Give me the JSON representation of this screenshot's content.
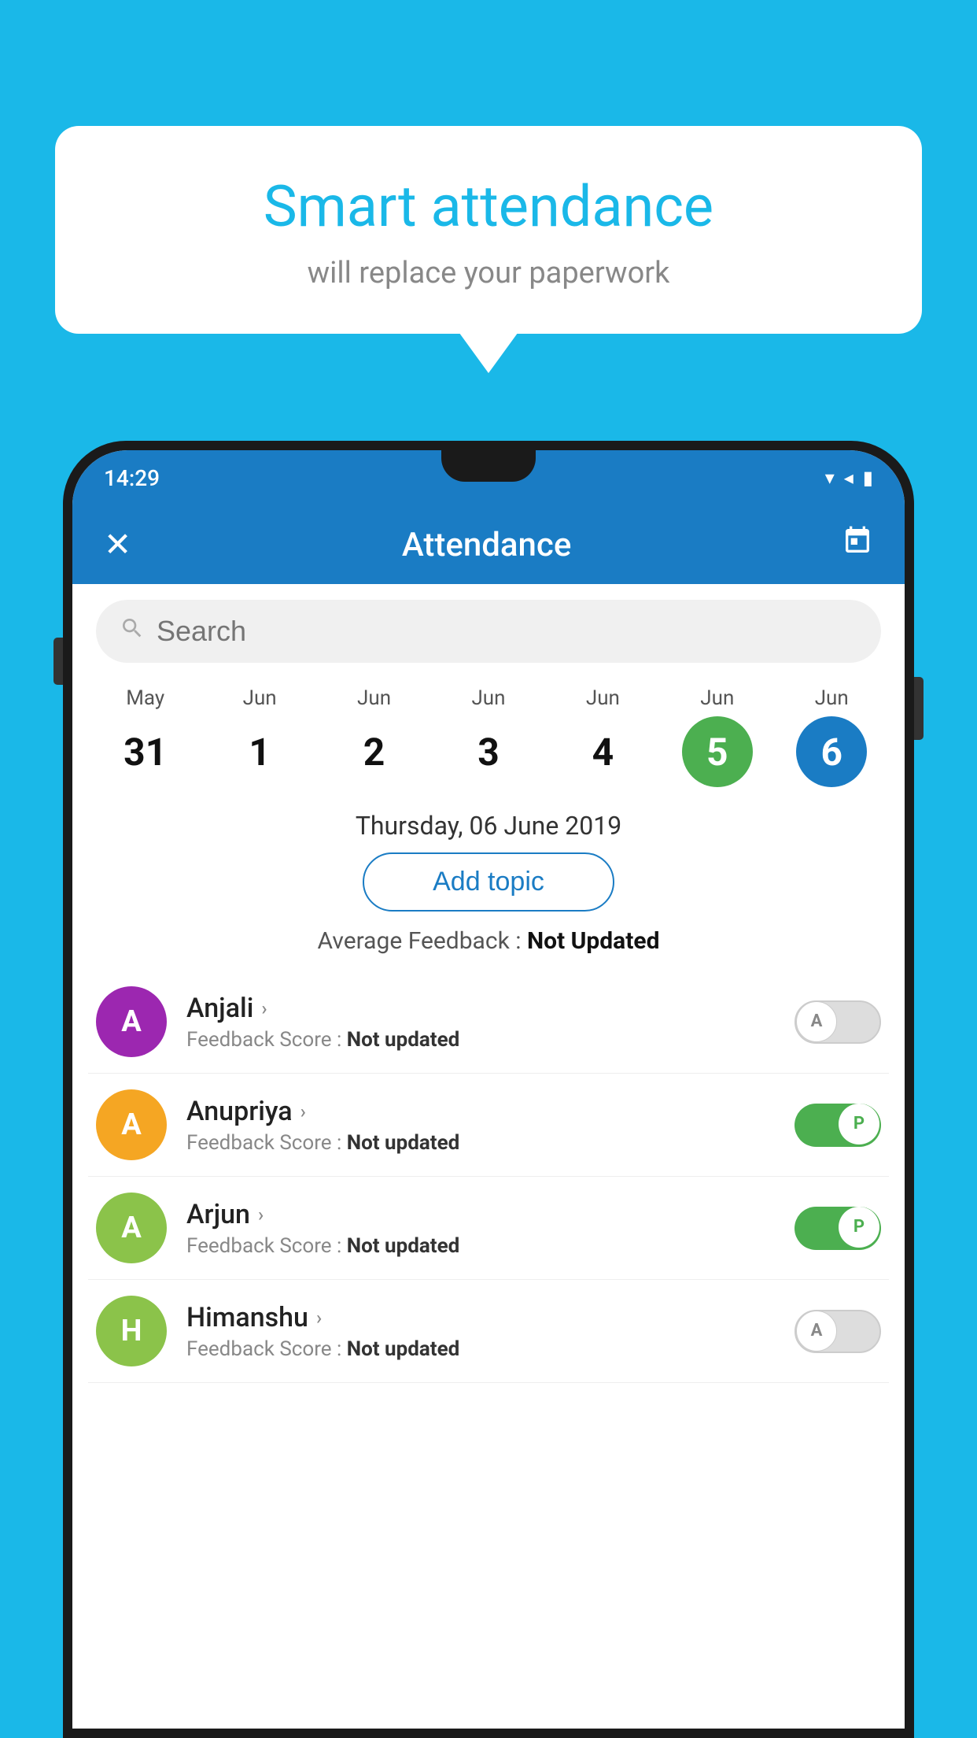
{
  "background": {
    "color": "#1ab8e8"
  },
  "speech_bubble": {
    "title": "Smart attendance",
    "subtitle": "will replace your paperwork"
  },
  "status_bar": {
    "time": "14:29",
    "wifi_icon": "▼",
    "signal_icon": "◀",
    "battery_icon": "▮"
  },
  "app_bar": {
    "close_label": "✕",
    "title": "Attendance",
    "calendar_icon": "📅"
  },
  "search": {
    "placeholder": "Search"
  },
  "calendar": {
    "days": [
      {
        "month": "May",
        "day": "31",
        "style": "normal"
      },
      {
        "month": "Jun",
        "day": "1",
        "style": "normal"
      },
      {
        "month": "Jun",
        "day": "2",
        "style": "normal"
      },
      {
        "month": "Jun",
        "day": "3",
        "style": "normal"
      },
      {
        "month": "Jun",
        "day": "4",
        "style": "normal"
      },
      {
        "month": "Jun",
        "day": "5",
        "style": "green"
      },
      {
        "month": "Jun",
        "day": "6",
        "style": "blue"
      }
    ]
  },
  "selected_date": "Thursday, 06 June 2019",
  "add_topic_label": "Add topic",
  "average_feedback": {
    "label": "Average Feedback : ",
    "value": "Not Updated"
  },
  "students": [
    {
      "name": "Anjali",
      "initial": "A",
      "avatar_color": "#9c27b0",
      "feedback_label": "Feedback Score : ",
      "feedback_value": "Not updated",
      "toggle": "off",
      "toggle_letter": "A"
    },
    {
      "name": "Anupriya",
      "initial": "A",
      "avatar_color": "#f5a623",
      "feedback_label": "Feedback Score : ",
      "feedback_value": "Not updated",
      "toggle": "on",
      "toggle_letter": "P"
    },
    {
      "name": "Arjun",
      "initial": "A",
      "avatar_color": "#8bc34a",
      "feedback_label": "Feedback Score : ",
      "feedback_value": "Not updated",
      "toggle": "on",
      "toggle_letter": "P"
    },
    {
      "name": "Himanshu",
      "initial": "H",
      "avatar_color": "#8bc34a",
      "feedback_label": "Feedback Score : ",
      "feedback_value": "Not updated",
      "toggle": "off",
      "toggle_letter": "A"
    }
  ]
}
